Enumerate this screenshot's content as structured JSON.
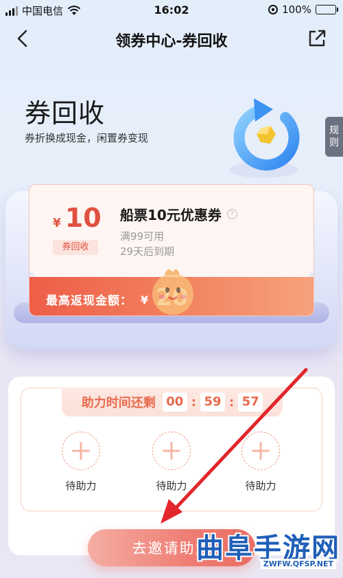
{
  "status_bar": {
    "carrier": "中国电信",
    "time": "16:02",
    "battery": "100%"
  },
  "nav": {
    "title": "领券中心-券回收"
  },
  "hero": {
    "title": "券回收",
    "subtitle": "券折换成现金，闲置券变现",
    "rules_tab": [
      "规",
      "则"
    ]
  },
  "coupon": {
    "currency": "¥",
    "amount": "10",
    "type_badge": "券回收",
    "name": "船票10元优惠券",
    "help": "?",
    "condition": "满99可用",
    "expiry": "29天后到期",
    "max_cashback_label": "最高返现金额：",
    "max_cashback_currency": "¥",
    "max_cashback_value": "20"
  },
  "assist": {
    "timer_label": "助力时间还剩",
    "hours": "00",
    "minutes": "59",
    "seconds": "57",
    "colon": ":",
    "helpers": [
      {
        "label": "待助力"
      },
      {
        "label": "待助力"
      },
      {
        "label": "待助力"
      }
    ],
    "invite_button": "去邀请助力"
  },
  "watermark": {
    "name": "曲阜手游网",
    "url": "ZWFW.QFSP.NET"
  },
  "colors": {
    "accent": "#e0513f",
    "timer": "#e86a4d",
    "arrow": "#e2262c",
    "watermark": "#1f5fb8"
  }
}
